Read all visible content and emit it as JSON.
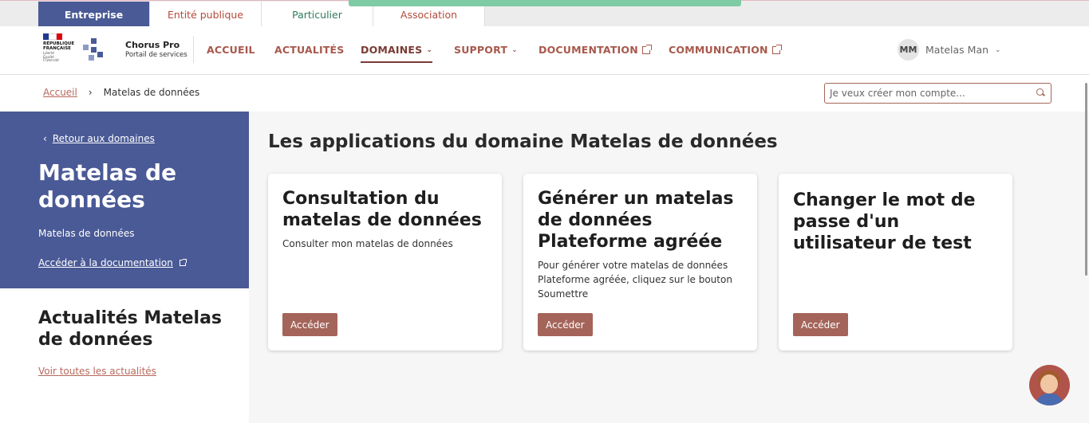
{
  "audience_tabs": [
    "Entreprise",
    "Entité publique",
    "Particulier",
    "Association"
  ],
  "brand": {
    "republic_lines": [
      "RÉPUBLIQUE",
      "FRANÇAISE"
    ],
    "motto": [
      "Liberté",
      "Égalité",
      "Fraternité"
    ],
    "name": "Chorus Pro",
    "tagline": "Portail de services"
  },
  "nav": {
    "accueil": "ACCUEIL",
    "actualites": "ACTUALITÉS",
    "domaines": "DOMAINES",
    "support": "SUPPORT",
    "documentation": "DOCUMENTATION",
    "communication": "COMMUNICATION"
  },
  "user": {
    "initials": "MM",
    "name": "Matelas Man"
  },
  "breadcrumb": {
    "home": "Accueil",
    "separator": "›",
    "current": "Matelas de données"
  },
  "search": {
    "placeholder": "Je veux créer mon compte..."
  },
  "sidebar": {
    "back_arrow": "‹",
    "back_label": "Retour aux domaines",
    "title": "Matelas de données",
    "subtitle": "Matelas de données",
    "doc_link": "Accéder à la documentation"
  },
  "news": {
    "title": "Actualités Matelas de données",
    "link": "Voir toutes les actualités"
  },
  "main": {
    "title": "Les applications du domaine Matelas de données",
    "cards": [
      {
        "title": "Consultation du matelas de données",
        "description": "Consulter mon matelas de données",
        "button": "Accéder"
      },
      {
        "title": "Générer un matelas de données Plateforme agréée",
        "description": "Pour générer votre matelas de données Plateforme agréée, cliquez sur le bouton Soumettre",
        "button": "Accéder"
      },
      {
        "title": "Changer le mot de passe d'un utilisateur de test",
        "description": "",
        "button": "Accéder"
      }
    ]
  },
  "colors": {
    "primary_blue": "#4a5a96",
    "accent_brown": "#a4645a",
    "green": "#7fcba3"
  }
}
